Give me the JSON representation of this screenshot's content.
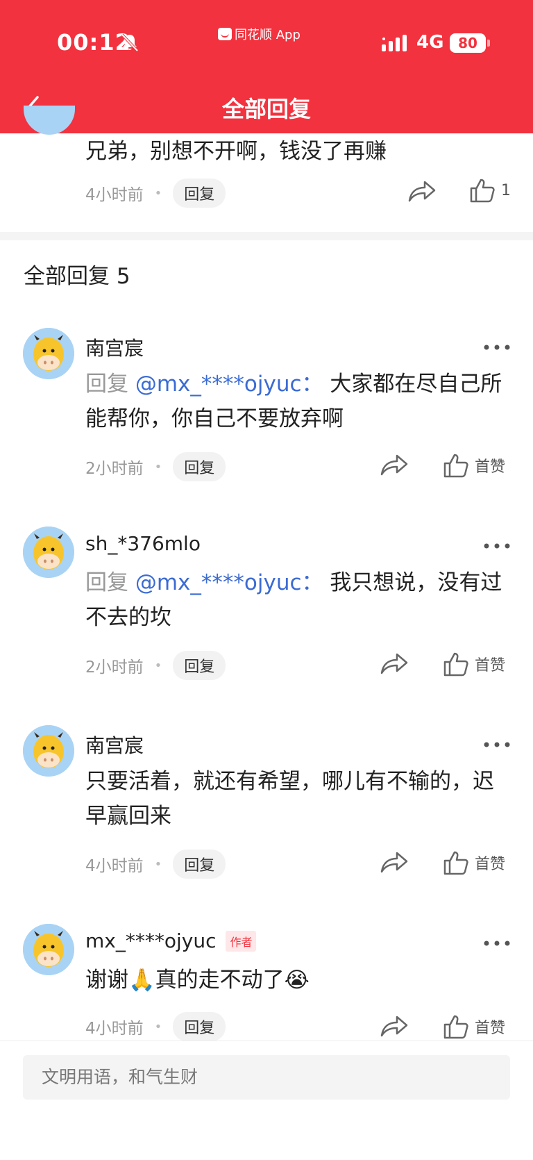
{
  "status_bar": {
    "time": "00:12",
    "app_name": "同花顺 App",
    "network": "4G",
    "battery": "80"
  },
  "nav": {
    "title": "全部回复"
  },
  "parent_comment": {
    "text": "兄弟，别想不开啊，钱没了再赚",
    "time": "4小时前",
    "reply_label": "回复",
    "like_count": "1"
  },
  "replies_section": {
    "title": "全部回复 5"
  },
  "comments": [
    {
      "username": "南宫宸",
      "reply_prefix": "回复",
      "mention": "@mx_****ojyuc：",
      "text": "大家都在尽自己所能帮你，你自己不要放弃啊",
      "time": "2小时前",
      "reply_label": "回复",
      "like_label": "首赞"
    },
    {
      "username": "sh_*376mlo",
      "reply_prefix": "回复",
      "mention": "@mx_****ojyuc：",
      "text": "我只想说，没有过不去的坎",
      "time": "2小时前",
      "reply_label": "回复",
      "like_label": "首赞"
    },
    {
      "username": "南宫宸",
      "text": "只要活着，就还有希望，哪儿有不输的，迟早赢回来",
      "time": "4小时前",
      "reply_label": "回复",
      "like_label": "首赞"
    },
    {
      "username": "mx_****ojyuc",
      "author_tag": "作者",
      "text": "谢谢🙏真的走不动了😭",
      "time": "4小时前",
      "reply_label": "回复",
      "like_label": "首赞"
    }
  ],
  "input": {
    "placeholder": "文明用语，和气生财"
  }
}
